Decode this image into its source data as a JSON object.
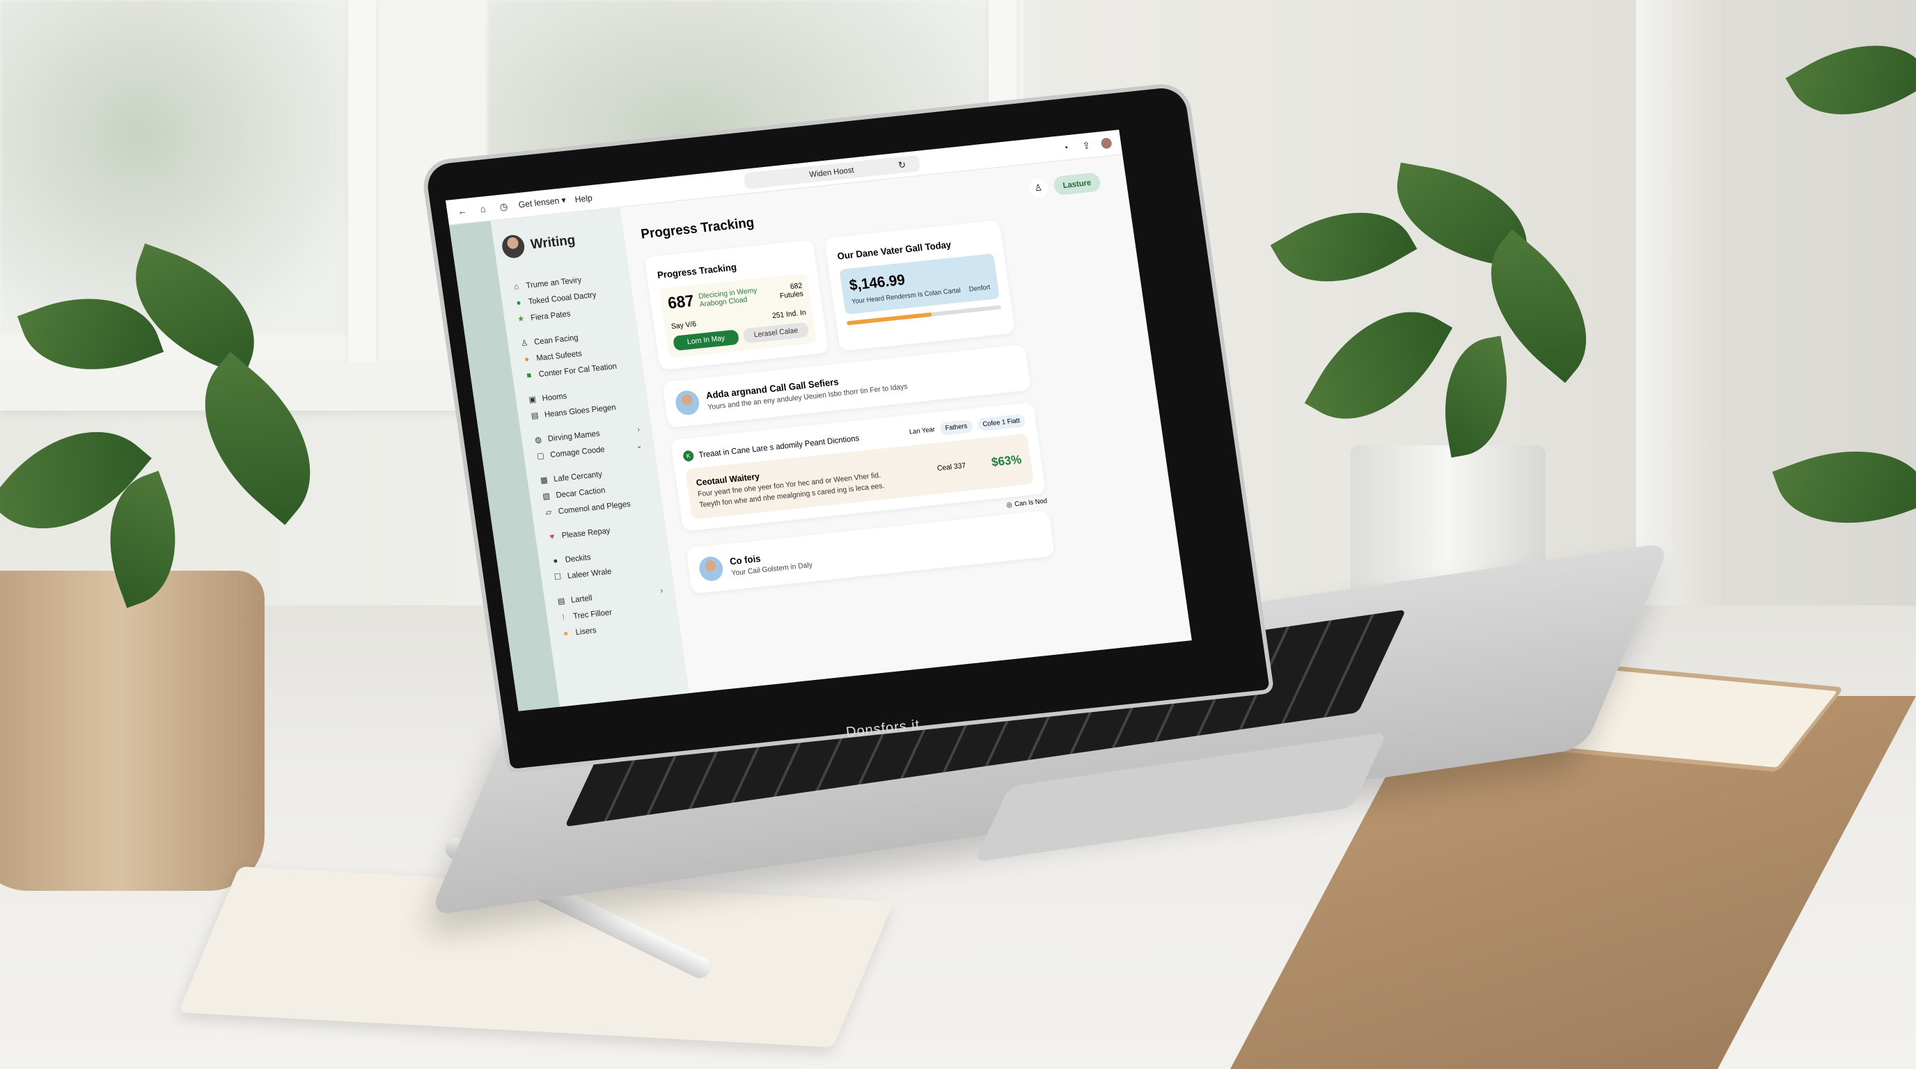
{
  "laptop": {
    "brand": "Donsfors it"
  },
  "browser": {
    "back_icon": "←",
    "home_icon": "⌂",
    "history_icon": "◷",
    "menu_label": "Get lensen ▾",
    "help_label": "Help",
    "url": "Widen Hoost",
    "reload_icon": "↻",
    "clock_icon": "◔",
    "share_icon": "⇪"
  },
  "sidebar": {
    "title": "Writing",
    "items": [
      {
        "icon": "⌂",
        "label": "Trume an Teviry",
        "color": "#333"
      },
      {
        "icon": "●",
        "label": "Toked Cooal Dactry",
        "color": "#2c8a47"
      },
      {
        "icon": "★",
        "label": "Fiera Pates",
        "color": "#4a9a35"
      },
      {
        "icon": "♙",
        "label": "Cean Facing",
        "color": "#333"
      },
      {
        "icon": "●",
        "label": "Mact Sufeets",
        "color": "#f08a30"
      },
      {
        "icon": "■",
        "label": "Conter For Cal Teation",
        "color": "#2c8a47"
      },
      {
        "icon": "▣",
        "label": "Hooms",
        "color": "#333"
      },
      {
        "icon": "▤",
        "label": "Heans Gloes Piegen",
        "color": "#333"
      },
      {
        "icon": "◍",
        "label": "Dirving Mames",
        "color": "#333",
        "chevron": "›"
      },
      {
        "icon": "▢",
        "label": "Comage Coode",
        "color": "#333",
        "chevron": "⌄"
      },
      {
        "icon": "▦",
        "label": "Lafe Cercanty",
        "color": "#333"
      },
      {
        "icon": "▧",
        "label": "Decar Caction",
        "color": "#333"
      },
      {
        "icon": "▱",
        "label": "Comenol and Pleges",
        "color": "#333"
      },
      {
        "icon": "♥",
        "label": "Please Repay",
        "color": "#e04545"
      },
      {
        "icon": "●",
        "label": "Deckits",
        "color": "#1f3a5c"
      },
      {
        "icon": "☐",
        "label": "Laleer Wrale",
        "color": "#333"
      },
      {
        "icon": "▤",
        "label": "Lartell",
        "color": "#333",
        "chevron": "›"
      },
      {
        "icon": "!",
        "label": "Trec Filloer",
        "color": "#e0552f"
      },
      {
        "icon": "●",
        "label": "Lisers",
        "color": "#f0a03b"
      }
    ]
  },
  "main": {
    "title": "Progress Tracking",
    "profile_icon": "♙",
    "action_pill": "Lasture",
    "progress_card": {
      "title": "Progress Tracking",
      "value": "687",
      "desc_line1": "Dlecicing in Wemy",
      "desc_line2": "Arabogn Cload",
      "right_value": "682",
      "right_label": "Futules",
      "sub_left": "Say V/6",
      "sub_right": "251 Ind. In",
      "primary_button": "Lorn In May",
      "secondary_button": "Lerasel Calae"
    },
    "goal_card": {
      "title": "Our Dane Vater Gall Today",
      "amount": "$,146.99",
      "line": "Your Heard Rendersm Is Colan Cartal",
      "line_right": "Denfort",
      "progress_percent": 55
    },
    "person_card": {
      "title": "Adda argnand Call Gall Sefiers",
      "subtitle": "Yours and the an eny anduley Ueuien Isbo thorr tin Fer to Idays"
    },
    "insight_card": {
      "badge": "K",
      "title": "Treaat in Cane Lare s adomily Peant Dicntions",
      "chips_label": "Lan Year",
      "chips": [
        "Fathers",
        "Cofee 1 Fiatt"
      ],
      "item_title": "Ceotaul Waitery",
      "item_desc_1": "Four yeart fne ohe yeer fon Yor hec and or Ween Vher fid.",
      "item_desc_2": "Teeyth fon whe and nhe mealgning s cared ing is leca ees.",
      "item_mid": "Ceal 337",
      "item_value": "$63%"
    },
    "status": {
      "icon": "◎",
      "label": "Can Is Nod"
    },
    "person2_card": {
      "title": "Co fois",
      "subtitle": "Your Cail Golstem in Daly"
    }
  }
}
